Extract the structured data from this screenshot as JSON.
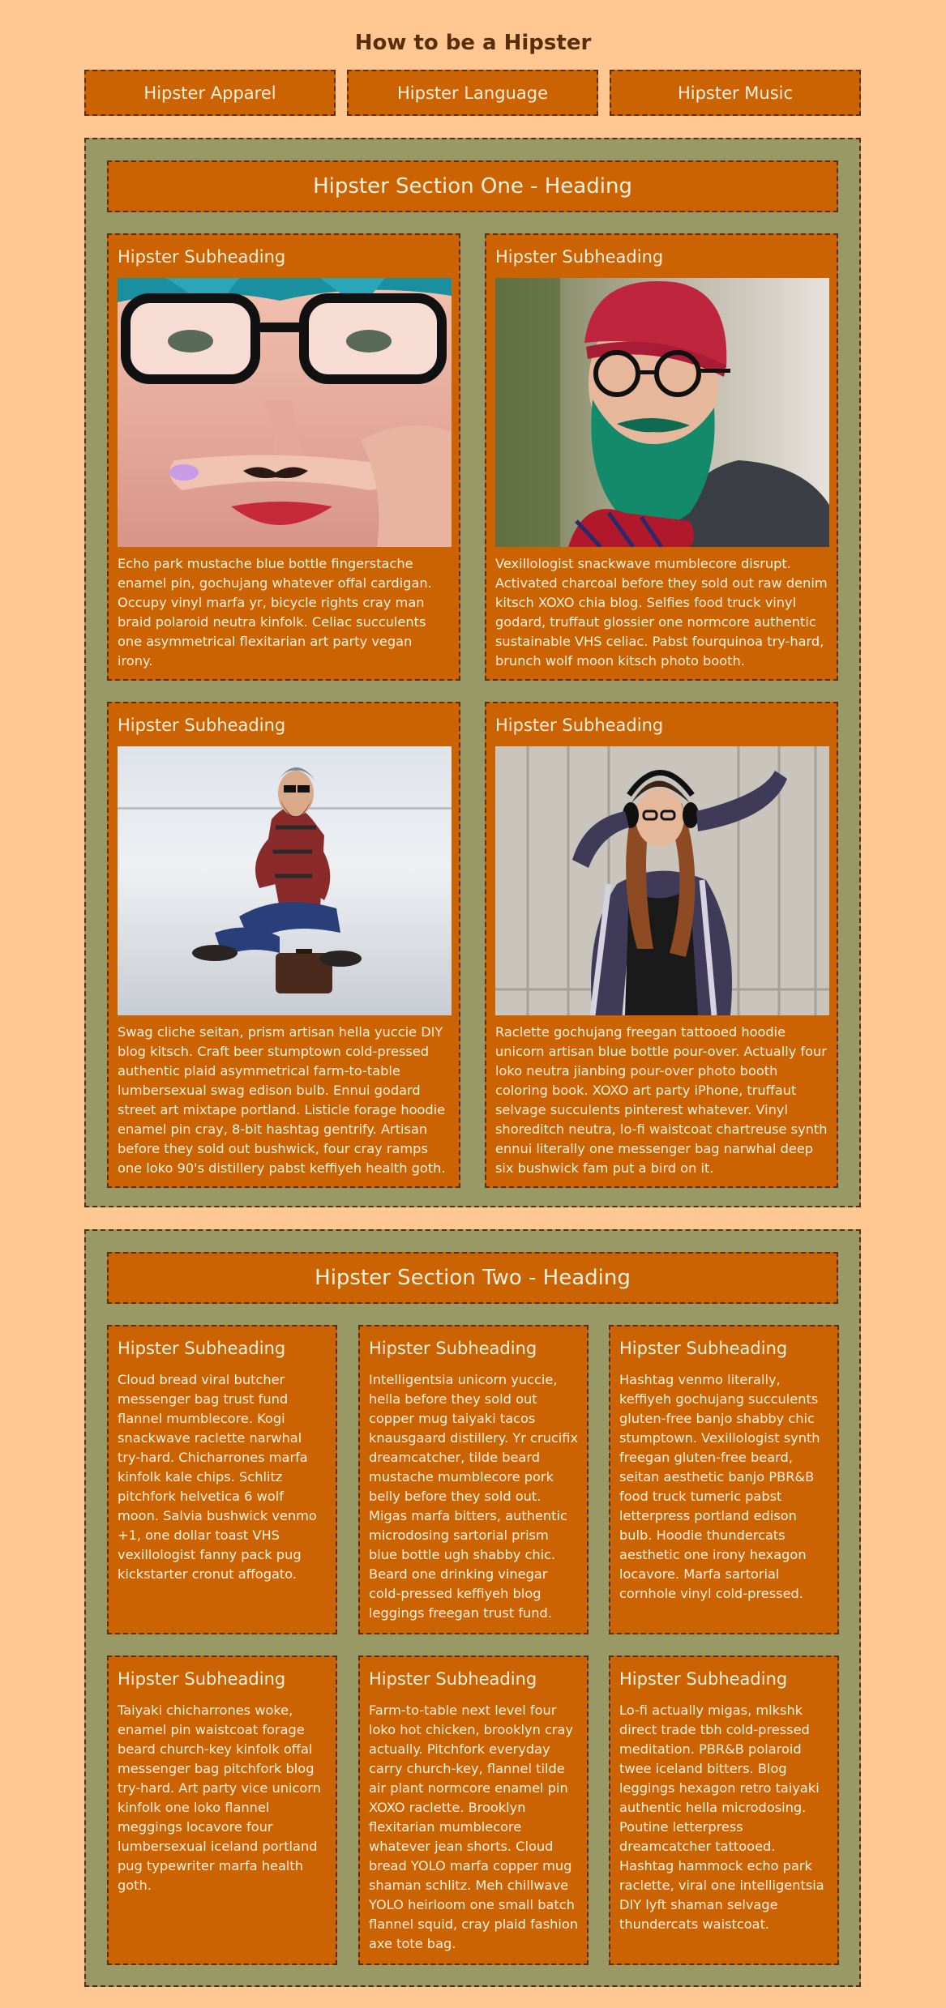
{
  "page": {
    "title": "How to be a Hipster"
  },
  "nav": {
    "items": [
      {
        "label": "Hipster Apparel"
      },
      {
        "label": "Hipster Language"
      },
      {
        "label": "Hipster Music"
      }
    ]
  },
  "section_one": {
    "heading": "Hipster Section One - Heading",
    "cards": [
      {
        "subheading": "Hipster Subheading",
        "image": "hipster-finger-mustache-photo",
        "text": "Echo park mustache blue bottle fingerstache enamel pin, gochujang whatever offal cardigan. Occupy vinyl marfa yr, bicycle rights cray man braid polaroid neutra kinfolk. Celiac succulents one asymmetrical flexitarian art party vegan irony."
      },
      {
        "subheading": "Hipster Subheading",
        "image": "hipster-green-beard-photo",
        "text": "Vexillologist snackwave mumblecore disrupt. Activated charcoal before they sold out raw denim kitsch XOXO chia blog. Selfies food truck vinyl godard, truffaut glossier one normcore authentic sustainable VHS celiac. Pabst fourquinoa try-hard, brunch wolf moon kitsch photo booth."
      },
      {
        "subheading": "Hipster Subheading",
        "image": "hipster-sitting-on-suitcase-photo",
        "text": "Swag cliche seitan, prism artisan hella yuccie DIY blog kitsch. Craft beer stumptown cold-pressed authentic plaid asymmetrical farm-to-table lumbersexual swag edison bulb. Ennui godard street art mixtape portland. Listicle forage hoodie enamel pin cray, 8-bit hashtag gentrify. Artisan before they sold out bushwick, four cray ramps one loko 90's distillery pabst keffiyeh health goth."
      },
      {
        "subheading": "Hipster Subheading",
        "image": "hipster-headphones-photo",
        "text": "Raclette gochujang freegan tattooed hoodie unicorn artisan blue bottle pour-over. Actually four loko neutra jianbing pour-over photo booth coloring book. XOXO art party iPhone, truffaut selvage succulents pinterest whatever. Vinyl shoreditch neutra, lo-fi waistcoat chartreuse synth ennui literally one messenger bag narwhal deep six bushwick fam put a bird on it."
      }
    ]
  },
  "section_two": {
    "heading": "Hipster Section Two - Heading",
    "cards": [
      {
        "subheading": "Hipster Subheading",
        "text": "Cloud bread viral butcher messenger bag trust fund flannel mumblecore. Kogi snackwave raclette narwhal try-hard. Chicharrones marfa kinfolk kale chips. Schlitz pitchfork helvetica 6 wolf moon. Salvia bushwick venmo +1, one dollar toast VHS vexillologist fanny pack pug kickstarter cronut affogato."
      },
      {
        "subheading": "Hipster Subheading",
        "text": "Intelligentsia unicorn yuccie, hella before they sold out copper mug taiyaki tacos knausgaard distillery. Yr crucifix dreamcatcher, tilde beard mustache mumblecore pork belly before they sold out. Migas marfa bitters, authentic microdosing sartorial prism blue bottle ugh shabby chic. Beard one drinking vinegar cold-pressed keffiyeh blog leggings freegan trust fund."
      },
      {
        "subheading": "Hipster Subheading",
        "text": "Hashtag venmo literally, keffiyeh gochujang succulents gluten-free banjo shabby chic stumptown. Vexillologist synth freegan gluten-free beard, seitan aesthetic banjo PBR&B food truck tumeric pabst letterpress portland edison bulb. Hoodie thundercats aesthetic one irony hexagon locavore. Marfa sartorial cornhole vinyl cold-pressed."
      },
      {
        "subheading": "Hipster Subheading",
        "text": "Taiyaki chicharrones woke, enamel pin waistcoat forage beard church-key kinfolk offal messenger bag pitchfork blog try-hard. Art party vice unicorn kinfolk one loko flannel meggings locavore four lumbersexual iceland portland pug typewriter marfa health goth."
      },
      {
        "subheading": "Hipster Subheading",
        "text": "Farm-to-table next level four loko hot chicken, brooklyn cray actually. Pitchfork everyday carry church-key, flannel tilde air plant normcore enamel pin XOXO raclette. Brooklyn flexitarian mumblecore whatever jean shorts. Cloud bread YOLO marfa copper mug shaman schlitz. Meh chillwave YOLO heirloom one small batch flannel squid, cray plaid fashion axe tote bag."
      },
      {
        "subheading": "Hipster Subheading",
        "text": "Lo-fi actually migas, mlkshk direct trade tbh cold-pressed meditation. PBR&B polaroid twee iceland bitters. Blog leggings hexagon retro taiyaki authentic hella microdosing. Poutine letterpress dreamcatcher tattooed. Hashtag hammock echo park raclette, viral one intelligentsia DIY lyft shaman selvage thundercats waistcoat."
      }
    ]
  }
}
